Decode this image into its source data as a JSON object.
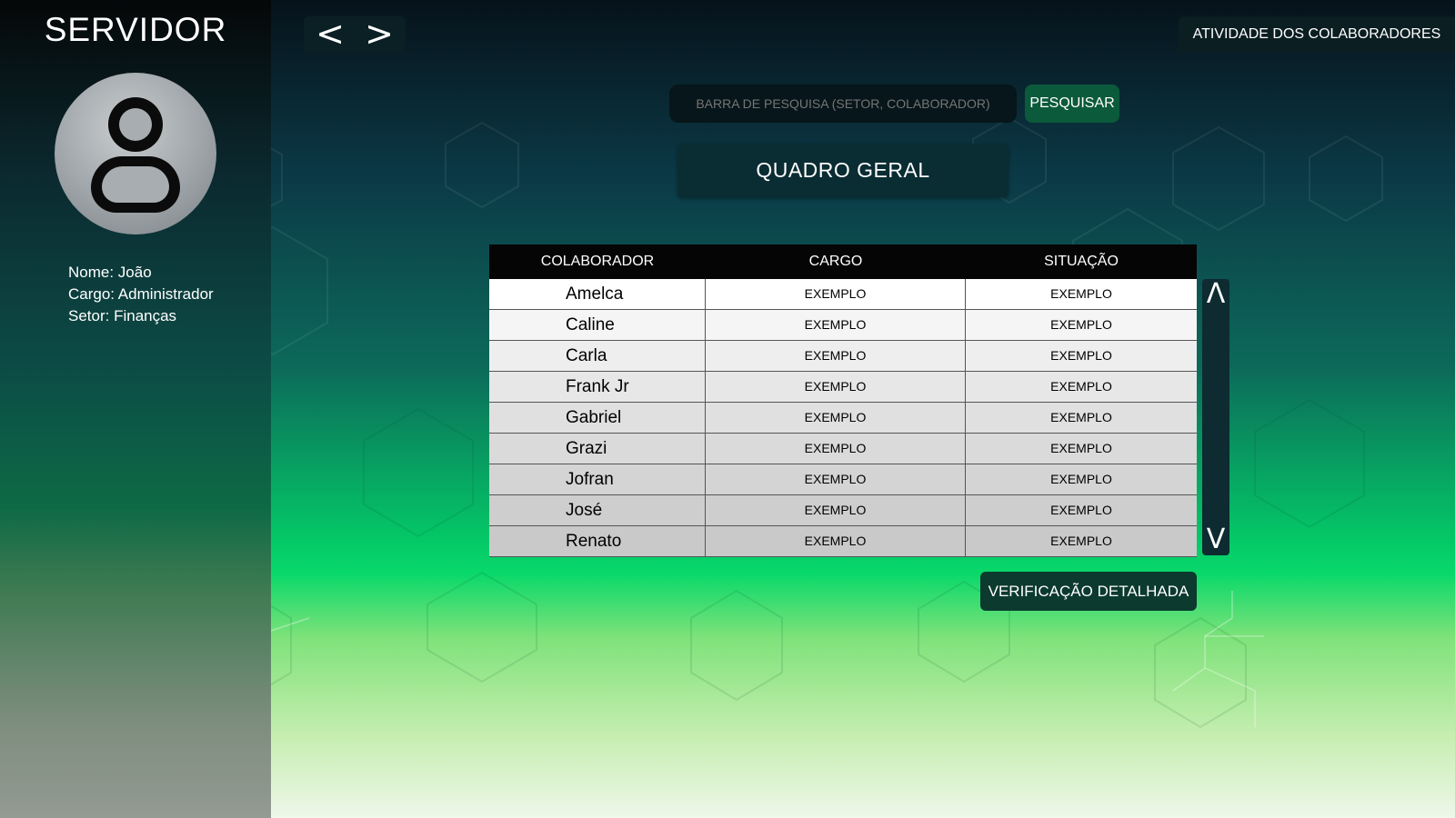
{
  "sidebar": {
    "app_title": "SERVIDOR",
    "profile": {
      "name": "Nome: João",
      "role": "Cargo: Administrador",
      "sector": "Setor: Finanças"
    }
  },
  "nav": {
    "back_label": "<",
    "forward_label": ">"
  },
  "header": {
    "activity_button": "ATIVIDADE DOS COLABORADORES"
  },
  "search": {
    "placeholder": "BARRA DE PESQUISA (SETOR, COLABORADOR)",
    "button_label": "PESQUISAR"
  },
  "main": {
    "title": "QUADRO GERAL",
    "columns": [
      "COLABORADOR",
      "CARGO",
      "SITUAÇÃO"
    ],
    "rows": [
      {
        "name": "Amelca",
        "cargo": "EXEMPLO",
        "situacao": "EXEMPLO"
      },
      {
        "name": "Caline",
        "cargo": "EXEMPLO",
        "situacao": "EXEMPLO"
      },
      {
        "name": "Carla",
        "cargo": "EXEMPLO",
        "situacao": "EXEMPLO"
      },
      {
        "name": "Frank Jr",
        "cargo": "EXEMPLO",
        "situacao": "EXEMPLO"
      },
      {
        "name": "Gabriel",
        "cargo": "EXEMPLO",
        "situacao": "EXEMPLO"
      },
      {
        "name": "Grazi",
        "cargo": "EXEMPLO",
        "situacao": "EXEMPLO"
      },
      {
        "name": "Jofran",
        "cargo": "EXEMPLO",
        "situacao": "EXEMPLO"
      },
      {
        "name": "José",
        "cargo": "EXEMPLO",
        "situacao": "EXEMPLO"
      },
      {
        "name": "Renato",
        "cargo": "EXEMPLO",
        "situacao": "EXEMPLO"
      }
    ],
    "scroll": {
      "up_label": "Λ",
      "down_label": "V"
    },
    "detail_button": "VERIFICAÇÃO DETALHADA"
  },
  "icons": {
    "avatar": "user-avatar-icon"
  },
  "colors": {
    "accent_green": "#04c867",
    "button_dark": "#0b1e22",
    "table_header": "#050505"
  }
}
